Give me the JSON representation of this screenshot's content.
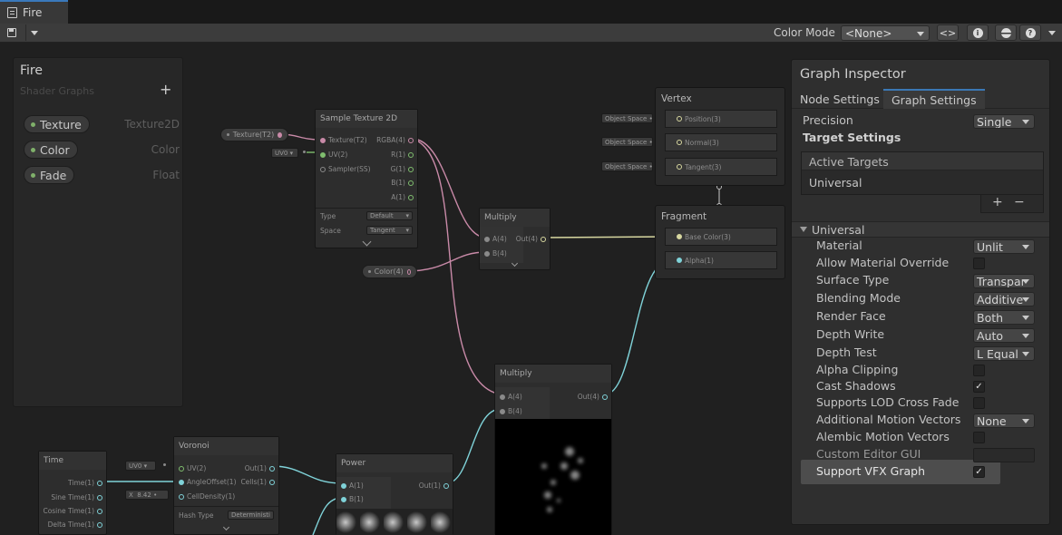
{
  "window": {
    "tab_title": "Fire"
  },
  "toolbar": {
    "color_mode_label": "Color Mode",
    "color_mode_value": "<None>"
  },
  "blackboard": {
    "title": "Fire",
    "subtitle": "Shader Graphs",
    "properties": [
      {
        "name": "Texture",
        "type": "Texture2D"
      },
      {
        "name": "Color",
        "type": "Color"
      },
      {
        "name": "Fade",
        "type": "Float"
      }
    ]
  },
  "nodes": {
    "sample_texture": {
      "title": "Sample Texture 2D",
      "inputs": [
        "Texture(T2)",
        "UV(2)",
        "Sampler(SS)"
      ],
      "outputs": [
        "RGBA(4)",
        "R(1)",
        "G(1)",
        "B(1)",
        "A(1)"
      ],
      "type_label": "Type",
      "type_value": "Default",
      "space_label": "Space",
      "space_value": "Tangent"
    },
    "texture_prop": {
      "label": "Texture(T2)"
    },
    "uv_field": {
      "label": "UV0"
    },
    "color_prop": {
      "label": "Color(4)"
    },
    "multiply1": {
      "title": "Multiply",
      "inputs": [
        "A(4)",
        "B(4)"
      ],
      "output": "Out(4)"
    },
    "multiply2": {
      "title": "Multiply",
      "inputs": [
        "A(4)",
        "B(4)"
      ],
      "output": "Out(4)"
    },
    "vertex": {
      "title": "Vertex",
      "slots": [
        {
          "label": "Position(3)",
          "bind": "Object Space"
        },
        {
          "label": "Normal(3)",
          "bind": "Object Space"
        },
        {
          "label": "Tangent(3)",
          "bind": "Object Space"
        }
      ]
    },
    "fragment": {
      "title": "Fragment",
      "slots": [
        "Base Color(3)",
        "Alpha(1)"
      ]
    },
    "time": {
      "title": "Time",
      "outputs": [
        "Time(1)",
        "Sine Time(1)",
        "Cosine Time(1)",
        "Delta Time(1)"
      ]
    },
    "voronoi": {
      "title": "Voronoi",
      "inputs": [
        "UV(2)",
        "AngleOffset(1)",
        "CellDensity(1)"
      ],
      "outputs": [
        "Out(1)",
        "Cells(1)"
      ],
      "uv_field": "UV0",
      "x_label": "X",
      "x_value": "8.42",
      "hash_label": "Hash Type",
      "hash_value": "Deterministi"
    },
    "power": {
      "title": "Power",
      "inputs": [
        "A(1)",
        "B(1)"
      ],
      "output": "Out(1)"
    }
  },
  "inspector": {
    "title": "Graph Inspector",
    "tabs": [
      "Node Settings",
      "Graph Settings"
    ],
    "precision_label": "Precision",
    "precision_value": "Single",
    "target_settings_label": "Target Settings",
    "active_targets_label": "Active Targets",
    "active_target": "Universal",
    "plus": "+",
    "minus": "−",
    "section": "Universal",
    "rows": [
      {
        "label": "Material",
        "kind": "select",
        "value": "Unlit"
      },
      {
        "label": "Allow Material Override",
        "kind": "check",
        "value": ""
      },
      {
        "label": "Surface Type",
        "kind": "select",
        "value": "Transpar"
      },
      {
        "label": "Blending Mode",
        "kind": "select",
        "value": "Additive"
      },
      {
        "label": "Render Face",
        "kind": "select",
        "value": "Both"
      },
      {
        "label": "Depth Write",
        "kind": "select",
        "value": "Auto"
      },
      {
        "label": "Depth Test",
        "kind": "select",
        "value": "L Equal"
      },
      {
        "label": "Alpha Clipping",
        "kind": "check",
        "value": ""
      },
      {
        "label": "Cast Shadows",
        "kind": "check",
        "value": "✓"
      },
      {
        "label": "Supports LOD Cross Fade",
        "kind": "check",
        "value": ""
      },
      {
        "label": "Additional Motion Vectors",
        "kind": "select",
        "value": "None"
      },
      {
        "label": "Alembic Motion Vectors",
        "kind": "check",
        "value": ""
      },
      {
        "label": "Custom Editor GUI",
        "kind": "field",
        "value": ""
      },
      {
        "label": "Support VFX Graph",
        "kind": "check",
        "value": "✓"
      }
    ]
  },
  "colors": {
    "accent": "#3b78b5",
    "wire_pink": "#c98aa8",
    "wire_teal": "#7fd2d8",
    "wire_yellow": "#d7d7a0",
    "wire_green": "#7fbd6e"
  }
}
